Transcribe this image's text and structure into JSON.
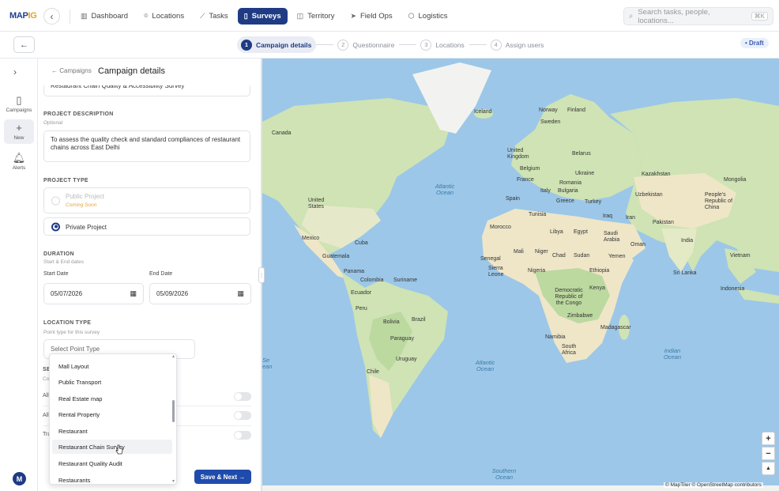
{
  "nav": {
    "logo_main": "MAP",
    "logo_accent": "IG",
    "items": [
      {
        "label": "Dashboard",
        "icon": "chart-icon"
      },
      {
        "label": "Locations",
        "icon": "pin-icon"
      },
      {
        "label": "Tasks",
        "icon": "tasks-icon"
      },
      {
        "label": "Surveys",
        "icon": "clipboard-icon"
      },
      {
        "label": "Territory",
        "icon": "map-icon"
      },
      {
        "label": "Field Ops",
        "icon": "send-icon"
      },
      {
        "label": "Logistics",
        "icon": "box-icon"
      }
    ],
    "search_placeholder": "Search tasks, people, locations...",
    "search_shortcut": "⌘K"
  },
  "steps": {
    "items": [
      {
        "num": "1",
        "label": "Campaign details"
      },
      {
        "num": "2",
        "label": "Questionnaire"
      },
      {
        "num": "3",
        "label": "Locations"
      },
      {
        "num": "4",
        "label": "Assign users"
      }
    ],
    "status": "• Draft"
  },
  "rail": {
    "items": [
      {
        "label": "Campaigns",
        "icon": "clipboard-icon"
      },
      {
        "label": "New",
        "icon": "plus-icon"
      },
      {
        "label": "Alerts",
        "icon": "bell-icon"
      }
    ],
    "avatar": "M"
  },
  "form": {
    "crumb_back": "← Campaigns",
    "title": "Campaign details",
    "name_value": "Restaurant Chain Quality & Accessibility Survey",
    "description": {
      "label": "PROJECT DESCRIPTION",
      "hint": "Optional",
      "value": "To assess the quality check and standard compliances of restaurant chains across East Delhi"
    },
    "project_type": {
      "label": "PROJECT TYPE",
      "public_label": "Public Project",
      "public_note": "Coming Soon",
      "private_label": "Private Project"
    },
    "duration": {
      "label": "DURATION",
      "hint": "Start & End dates",
      "start_label": "Start Date",
      "start_value": "05/07/2026",
      "end_label": "End Date",
      "end_value": "05/09/2026"
    },
    "location_type": {
      "label": "LOCATION TYPE",
      "hint": "Point type for this survey",
      "placeholder": "Select Point Type"
    },
    "truncated_rows": {
      "section_label": "SE",
      "section_hint": "Co",
      "row1": "All",
      "row2": "All",
      "row3": "Tra"
    },
    "save_label": "Save & Next →"
  },
  "dropdown": {
    "options": [
      "Mall Layout",
      "Public Transport",
      "Real Estate map",
      "Rental Property",
      "Restaurant",
      "Restaurant Chain Survey",
      "Restaurant Quality Audit",
      "Restaurants"
    ],
    "hovered_index": 5
  },
  "map": {
    "labels": {
      "iceland": "Iceland",
      "norway": "Norway",
      "finland": "Finland",
      "sweden": "Sweden",
      "canada": "Canada",
      "united_kingdom": "United Kingdom",
      "belarus": "Belarus",
      "belgium": "Belgium",
      "ukraine": "Ukraine",
      "kazakhstan": "Kazakhstan",
      "mongolia": "Mongolia",
      "france": "France",
      "romania": "Romania",
      "italy": "Italy",
      "bulgaria": "Bulgaria",
      "uzbekistan": "Uzbekistan",
      "china": "People's Republic of China",
      "united_states": "United States",
      "spain": "Spain",
      "greece": "Greece",
      "turkey": "Turkey",
      "atlantic_n": "Atlantic Ocean",
      "tunisia": "Tunisia",
      "iraq": "Iraq",
      "iran": "Iran",
      "pakistan": "Pakistan",
      "morocco": "Morocco",
      "libya": "Libya",
      "egypt": "Egypt",
      "saudi": "Saudi Arabia",
      "india": "India",
      "mexico": "Mexico",
      "cuba": "Cuba",
      "oman": "Oman",
      "mali": "Mali",
      "niger": "Niger",
      "senegal": "Senegal",
      "chad": "Chad",
      "sudan": "Sudan",
      "yemen": "Yemen",
      "vietnam": "Vietnam",
      "guatemala": "Guatemala",
      "sierra_leone": "Sierra Leone",
      "nigeria": "Nigeria",
      "ethiopia": "Ethiopia",
      "sri_lanka": "Sri Lanka",
      "panama": "Panama",
      "colombia": "Colombia",
      "suriname": "Suriname",
      "drc": "Democratic Republic of the Congo",
      "kenya": "Kenya",
      "ecuador": "Ecuador",
      "indonesia": "Indonesia",
      "peru": "Peru",
      "brazil": "Brazil",
      "bolivia": "Bolivia",
      "zimbabwe": "Zimbabwe",
      "madagascar": "Madagascar",
      "paraguay": "Paraguay",
      "namibia": "Namibia",
      "south_africa": "South Africa",
      "indian_ocean": "Indian Ocean",
      "atlantic_s": "Atlantic Ocean",
      "uruguay": "Uruguay",
      "chile": "Chile",
      "south_pacific_frag": "Se ean",
      "southern_ocean": "Southern Ocean"
    },
    "zoom_in": "+",
    "zoom_out": "−",
    "compass": "▲",
    "attribution": "© MapTiler © OpenStreetMap contributors"
  },
  "colors": {
    "brand": "#1f3b84",
    "accent": "#e8a21b",
    "water": "#9cc7e8",
    "land_green": "#cfe3b4",
    "land_sand": "#efe6c8"
  }
}
